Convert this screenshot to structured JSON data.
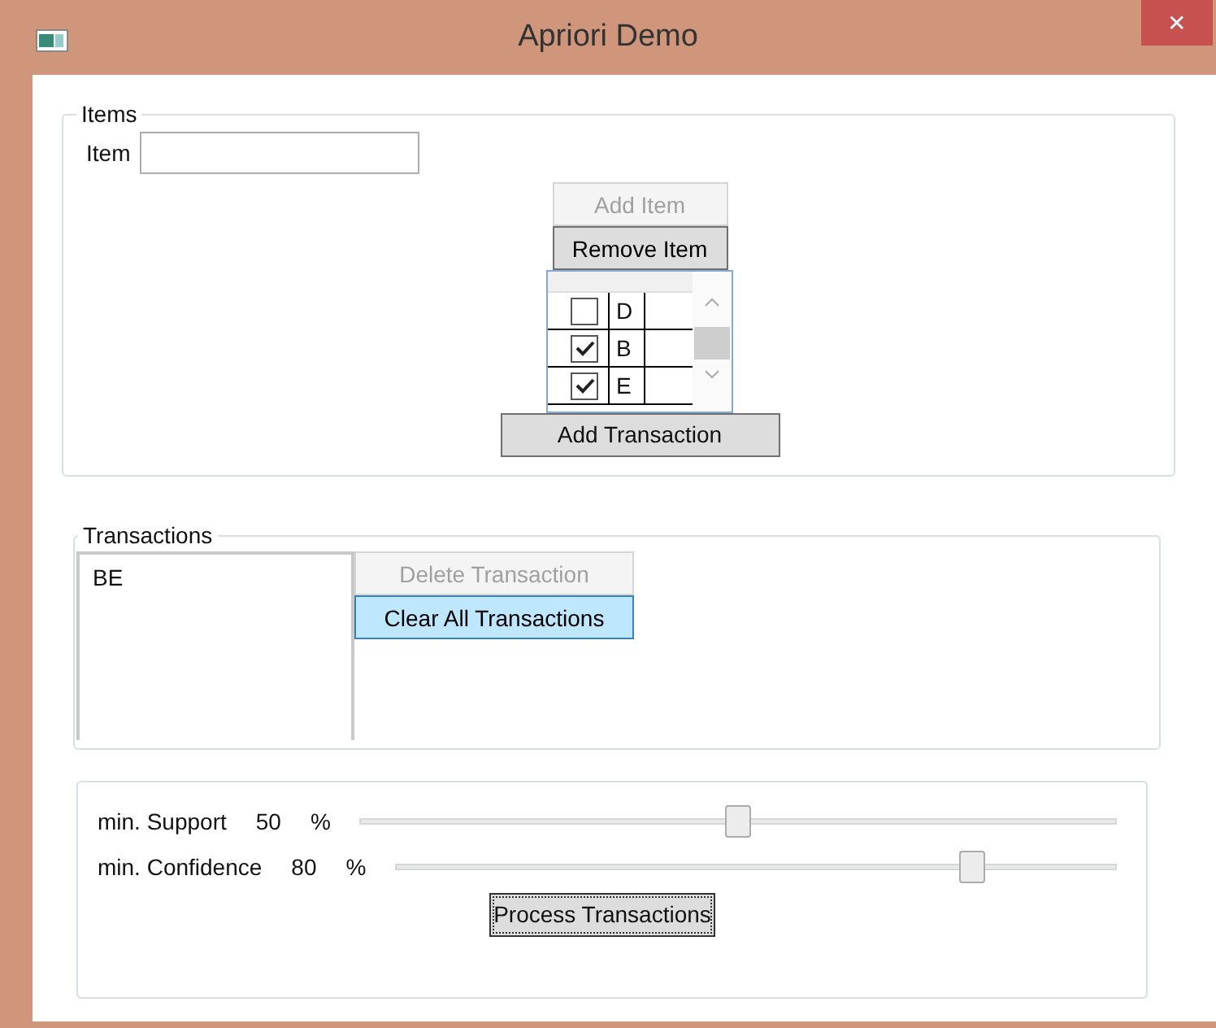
{
  "window": {
    "title": "Apriori Demo",
    "close": "✕"
  },
  "items": {
    "title": "Items",
    "item_label": "Item",
    "buttons": [
      {
        "label": "Add Item",
        "disabled": true
      },
      {
        "label": "Remove Item",
        "disabled": false
      }
    ],
    "grid_rows": [
      {
        "label": "D",
        "checked": false
      },
      {
        "label": "B",
        "checked": true
      },
      {
        "label": "E",
        "checked": true
      }
    ],
    "add_transaction": "Add Transaction"
  },
  "transactions": {
    "title": "Transactions",
    "list": [
      "BE"
    ],
    "buttons": [
      {
        "label": "Delete Transaction",
        "disabled": true,
        "hovered": false
      },
      {
        "label": "Clear All Transactions",
        "disabled": false,
        "hovered": true
      }
    ]
  },
  "settings": {
    "sliders": [
      {
        "label": "min. Support",
        "value": "50",
        "unit": "%",
        "level": 0.5
      },
      {
        "label": "min. Confidence",
        "value": "80",
        "unit": "%",
        "level": 0.8
      }
    ],
    "process": {
      "label": "Process Transactions",
      "focused": true
    }
  }
}
